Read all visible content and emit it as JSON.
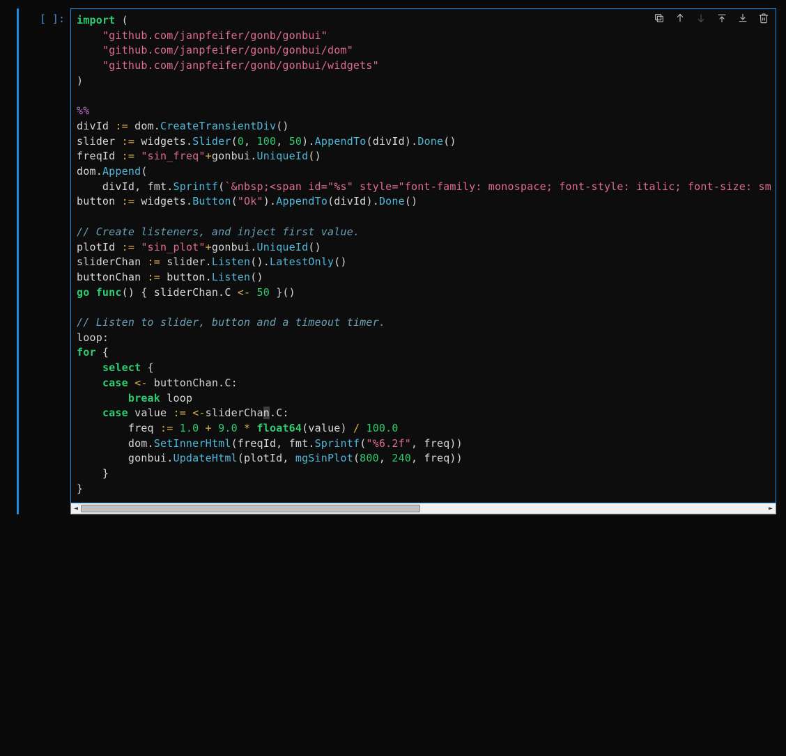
{
  "prompt": "[ ]:",
  "toolbar": {
    "duplicate": "duplicate",
    "move_up": "move-up",
    "move_down": "move-down",
    "insert_above": "insert-above",
    "insert_below": "insert-below",
    "delete": "delete"
  },
  "scrollbar": {
    "left_glyph": "◄",
    "right_glyph": "►"
  },
  "code_tokens": [
    [
      [
        "kw",
        "import"
      ],
      [
        "pun",
        " ("
      ]
    ],
    [
      [
        "pun",
        "    "
      ],
      [
        "str",
        "\"github.com/janpfeifer/gonb/gonbui\""
      ]
    ],
    [
      [
        "pun",
        "    "
      ],
      [
        "str",
        "\"github.com/janpfeifer/gonb/gonbui/dom\""
      ]
    ],
    [
      [
        "pun",
        "    "
      ],
      [
        "str",
        "\"github.com/janpfeifer/gonb/gonbui/widgets\""
      ]
    ],
    [
      [
        "pun",
        ")"
      ]
    ],
    [],
    [
      [
        "mag",
        "%%"
      ]
    ],
    [
      [
        "id",
        "divId "
      ],
      [
        "assn",
        ":="
      ],
      [
        "id",
        " dom"
      ],
      [
        "pun",
        "."
      ],
      [
        "call",
        "CreateTransientDiv"
      ],
      [
        "pun",
        "()"
      ]
    ],
    [
      [
        "id",
        "slider "
      ],
      [
        "assn",
        ":="
      ],
      [
        "id",
        " widgets"
      ],
      [
        "pun",
        "."
      ],
      [
        "call",
        "Slider"
      ],
      [
        "pun",
        "("
      ],
      [
        "num",
        "0"
      ],
      [
        "pun",
        ", "
      ],
      [
        "num",
        "100"
      ],
      [
        "pun",
        ", "
      ],
      [
        "num",
        "50"
      ],
      [
        "pun",
        ")."
      ],
      [
        "call",
        "AppendTo"
      ],
      [
        "pun",
        "(divId)."
      ],
      [
        "call",
        "Done"
      ],
      [
        "pun",
        "()"
      ]
    ],
    [
      [
        "id",
        "freqId "
      ],
      [
        "assn",
        ":="
      ],
      [
        "pun",
        " "
      ],
      [
        "str",
        "\"sin_freq\""
      ],
      [
        "op",
        "+"
      ],
      [
        "id",
        "gonbui"
      ],
      [
        "pun",
        "."
      ],
      [
        "call",
        "UniqueId"
      ],
      [
        "pun",
        "()"
      ]
    ],
    [
      [
        "id",
        "dom"
      ],
      [
        "pun",
        "."
      ],
      [
        "call",
        "Append"
      ],
      [
        "pun",
        "("
      ]
    ],
    [
      [
        "pun",
        "    divId, fmt."
      ],
      [
        "call",
        "Sprintf"
      ],
      [
        "pun",
        "("
      ],
      [
        "str",
        "`&nbsp;<span id=\"%s\" style=\"font-family: monospace; font-style: italic; font-size: sm"
      ]
    ],
    [
      [
        "id",
        "button "
      ],
      [
        "assn",
        ":="
      ],
      [
        "id",
        " widgets"
      ],
      [
        "pun",
        "."
      ],
      [
        "call",
        "Button"
      ],
      [
        "pun",
        "("
      ],
      [
        "str",
        "\"Ok\""
      ],
      [
        "pun",
        ")."
      ],
      [
        "call",
        "AppendTo"
      ],
      [
        "pun",
        "(divId)."
      ],
      [
        "call",
        "Done"
      ],
      [
        "pun",
        "()"
      ]
    ],
    [],
    [
      [
        "cmt",
        "// Create listeners, and inject first value."
      ]
    ],
    [
      [
        "id",
        "plotId "
      ],
      [
        "assn",
        ":="
      ],
      [
        "pun",
        " "
      ],
      [
        "str",
        "\"sin_plot\""
      ],
      [
        "op",
        "+"
      ],
      [
        "id",
        "gonbui"
      ],
      [
        "pun",
        "."
      ],
      [
        "call",
        "UniqueId"
      ],
      [
        "pun",
        "()"
      ]
    ],
    [
      [
        "id",
        "sliderChan "
      ],
      [
        "assn",
        ":="
      ],
      [
        "id",
        " slider"
      ],
      [
        "pun",
        "."
      ],
      [
        "call",
        "Listen"
      ],
      [
        "pun",
        "()."
      ],
      [
        "call",
        "LatestOnly"
      ],
      [
        "pun",
        "()"
      ]
    ],
    [
      [
        "id",
        "buttonChan "
      ],
      [
        "assn",
        ":="
      ],
      [
        "id",
        " button"
      ],
      [
        "pun",
        "."
      ],
      [
        "call",
        "Listen"
      ],
      [
        "pun",
        "()"
      ]
    ],
    [
      [
        "kw",
        "go"
      ],
      [
        "pun",
        " "
      ],
      [
        "func",
        "func"
      ],
      [
        "pun",
        "() { sliderChan.C "
      ],
      [
        "op",
        "<-"
      ],
      [
        "pun",
        " "
      ],
      [
        "num",
        "50"
      ],
      [
        "pun",
        " }()"
      ]
    ],
    [],
    [
      [
        "cmt",
        "// Listen to slider, button and a timeout timer."
      ]
    ],
    [
      [
        "id",
        "loop:"
      ]
    ],
    [
      [
        "kw",
        "for"
      ],
      [
        "pun",
        " {"
      ]
    ],
    [
      [
        "pun",
        "    "
      ],
      [
        "kw",
        "select"
      ],
      [
        "pun",
        " {"
      ]
    ],
    [
      [
        "pun",
        "    "
      ],
      [
        "kw",
        "case"
      ],
      [
        "pun",
        " "
      ],
      [
        "op",
        "<-"
      ],
      [
        "pun",
        " buttonChan.C:"
      ]
    ],
    [
      [
        "pun",
        "        "
      ],
      [
        "kw",
        "break"
      ],
      [
        "id",
        " loop"
      ]
    ],
    [
      [
        "pun",
        "    "
      ],
      [
        "kw",
        "case"
      ],
      [
        "id",
        " value "
      ],
      [
        "assn",
        ":="
      ],
      [
        "pun",
        " "
      ],
      [
        "op",
        "<-"
      ],
      [
        "id",
        "sliderCha"
      ],
      [
        "caret",
        "n"
      ],
      [
        "pun",
        ".C:"
      ]
    ],
    [
      [
        "pun",
        "        freq "
      ],
      [
        "assn",
        ":="
      ],
      [
        "pun",
        " "
      ],
      [
        "num",
        "1.0"
      ],
      [
        "pun",
        " "
      ],
      [
        "op",
        "+"
      ],
      [
        "pun",
        " "
      ],
      [
        "num",
        "9.0"
      ],
      [
        "pun",
        " "
      ],
      [
        "op",
        "*"
      ],
      [
        "pun",
        " "
      ],
      [
        "type",
        "float64"
      ],
      [
        "pun",
        "(value) "
      ],
      [
        "op",
        "/"
      ],
      [
        "pun",
        " "
      ],
      [
        "num",
        "100.0"
      ]
    ],
    [
      [
        "pun",
        "        dom."
      ],
      [
        "call",
        "SetInnerHtml"
      ],
      [
        "pun",
        "(freqId, fmt."
      ],
      [
        "call",
        "Sprintf"
      ],
      [
        "pun",
        "("
      ],
      [
        "str",
        "\"%6.2f\""
      ],
      [
        "pun",
        ", freq))"
      ]
    ],
    [
      [
        "pun",
        "        gonbui."
      ],
      [
        "call",
        "UpdateHtml"
      ],
      [
        "pun",
        "(plotId, "
      ],
      [
        "call",
        "mgSinPlot"
      ],
      [
        "pun",
        "("
      ],
      [
        "num",
        "800"
      ],
      [
        "pun",
        ", "
      ],
      [
        "num",
        "240"
      ],
      [
        "pun",
        ", freq))"
      ]
    ],
    [
      [
        "pun",
        "    }"
      ]
    ],
    [
      [
        "pun",
        "}"
      ]
    ]
  ]
}
